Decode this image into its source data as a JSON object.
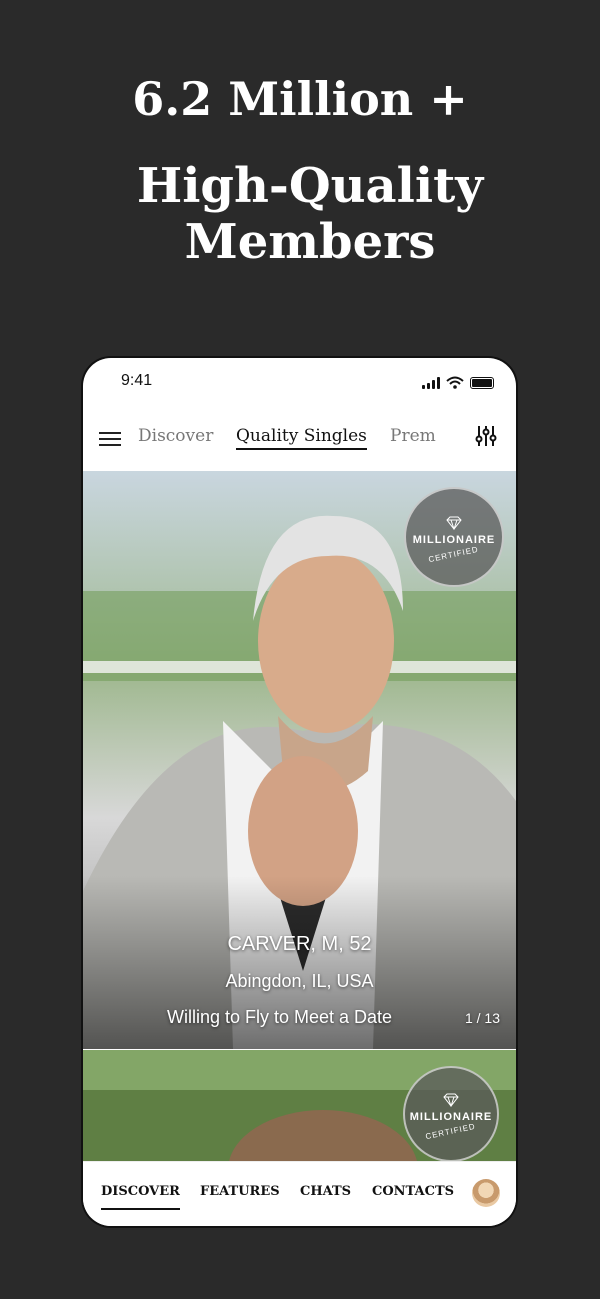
{
  "hero": {
    "line1": "6.2 Million +",
    "line2": "High-Quality Members"
  },
  "status": {
    "time": "9:41"
  },
  "topnav": {
    "tabs": [
      {
        "label": "Discover",
        "active": false
      },
      {
        "label": "Quality Singles",
        "active": true
      },
      {
        "label": "Prem",
        "active": false
      }
    ]
  },
  "profiles": [
    {
      "badge_title": "MILLIONAIRE",
      "badge_sub": "CERTIFIED",
      "name": "CARVER, M, 52",
      "location": "Abingdon, IL, USA",
      "tagline": "Willing to Fly to Meet a Date",
      "counter": "1 / 13"
    },
    {
      "badge_title": "MILLIONAIRE",
      "badge_sub": "CERTIFIED"
    }
  ],
  "bottomnav": {
    "items": [
      {
        "label": "DISCOVER",
        "active": true
      },
      {
        "label": "FEATURES",
        "active": false
      },
      {
        "label": "CHATS",
        "active": false
      },
      {
        "label": "CONTACTS",
        "active": false
      }
    ]
  },
  "colors": {
    "background": "#2a2a2a",
    "text_light": "#ffffff",
    "text_dark": "#111111"
  }
}
